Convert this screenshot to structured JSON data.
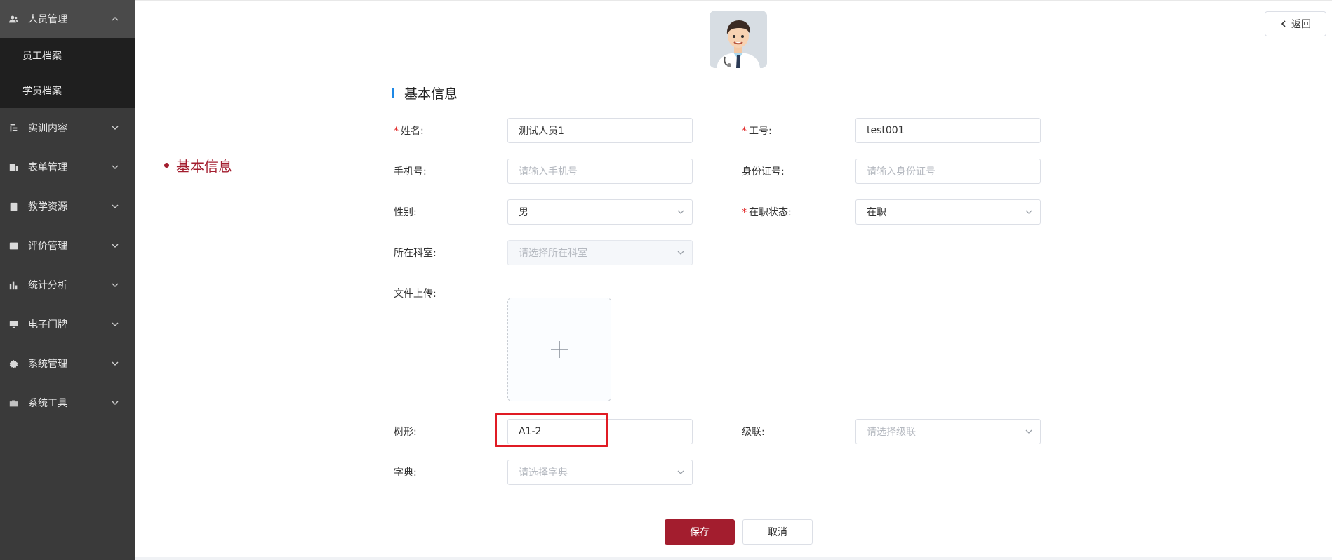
{
  "sidebar": {
    "items": [
      {
        "label": "人员管理",
        "icon": "users-icon",
        "expanded": true,
        "children": [
          "员工档案",
          "学员档案"
        ]
      },
      {
        "label": "实训内容",
        "icon": "training-icon"
      },
      {
        "label": "表单管理",
        "icon": "form-icon"
      },
      {
        "label": "教学资源",
        "icon": "resource-icon"
      },
      {
        "label": "评价管理",
        "icon": "evaluation-icon"
      },
      {
        "label": "统计分析",
        "icon": "bar-chart-icon"
      },
      {
        "label": "电子门牌",
        "icon": "monitor-icon"
      },
      {
        "label": "系统管理",
        "icon": "gear-icon"
      },
      {
        "label": "系统工具",
        "icon": "toolbox-icon"
      }
    ]
  },
  "header": {
    "back_label": "返回"
  },
  "anchor": {
    "label": "基本信息"
  },
  "section": {
    "title": "基本信息"
  },
  "form": {
    "name": {
      "label": "姓名:",
      "required": true,
      "value": "测试人员1"
    },
    "job_no": {
      "label": "工号:",
      "required": true,
      "value": "test001"
    },
    "phone": {
      "label": "手机号:",
      "placeholder": "请输入手机号"
    },
    "id_card": {
      "label": "身份证号:",
      "placeholder": "请输入身份证号"
    },
    "gender": {
      "label": "性别:",
      "value": "男"
    },
    "status": {
      "label": "在职状态:",
      "required": true,
      "value": "在职"
    },
    "department": {
      "label": "所在科室:",
      "placeholder": "请选择所在科室",
      "disabled": true
    },
    "upload": {
      "label": "文件上传:"
    },
    "tree": {
      "label": "树形:",
      "value": "A1-2"
    },
    "cascade": {
      "label": "级联:",
      "placeholder": "请选择级联"
    },
    "dict": {
      "label": "字典:",
      "placeholder": "请选择字典"
    }
  },
  "actions": {
    "save_label": "保存",
    "cancel_label": "取消"
  },
  "colors": {
    "primary": "#a31d2e",
    "sidebar_bg": "#3a3a3a",
    "submenu_bg": "#1f1f1f",
    "section_bar": "#1e88e5",
    "required": "#e02020",
    "highlight": "#e01b24"
  }
}
